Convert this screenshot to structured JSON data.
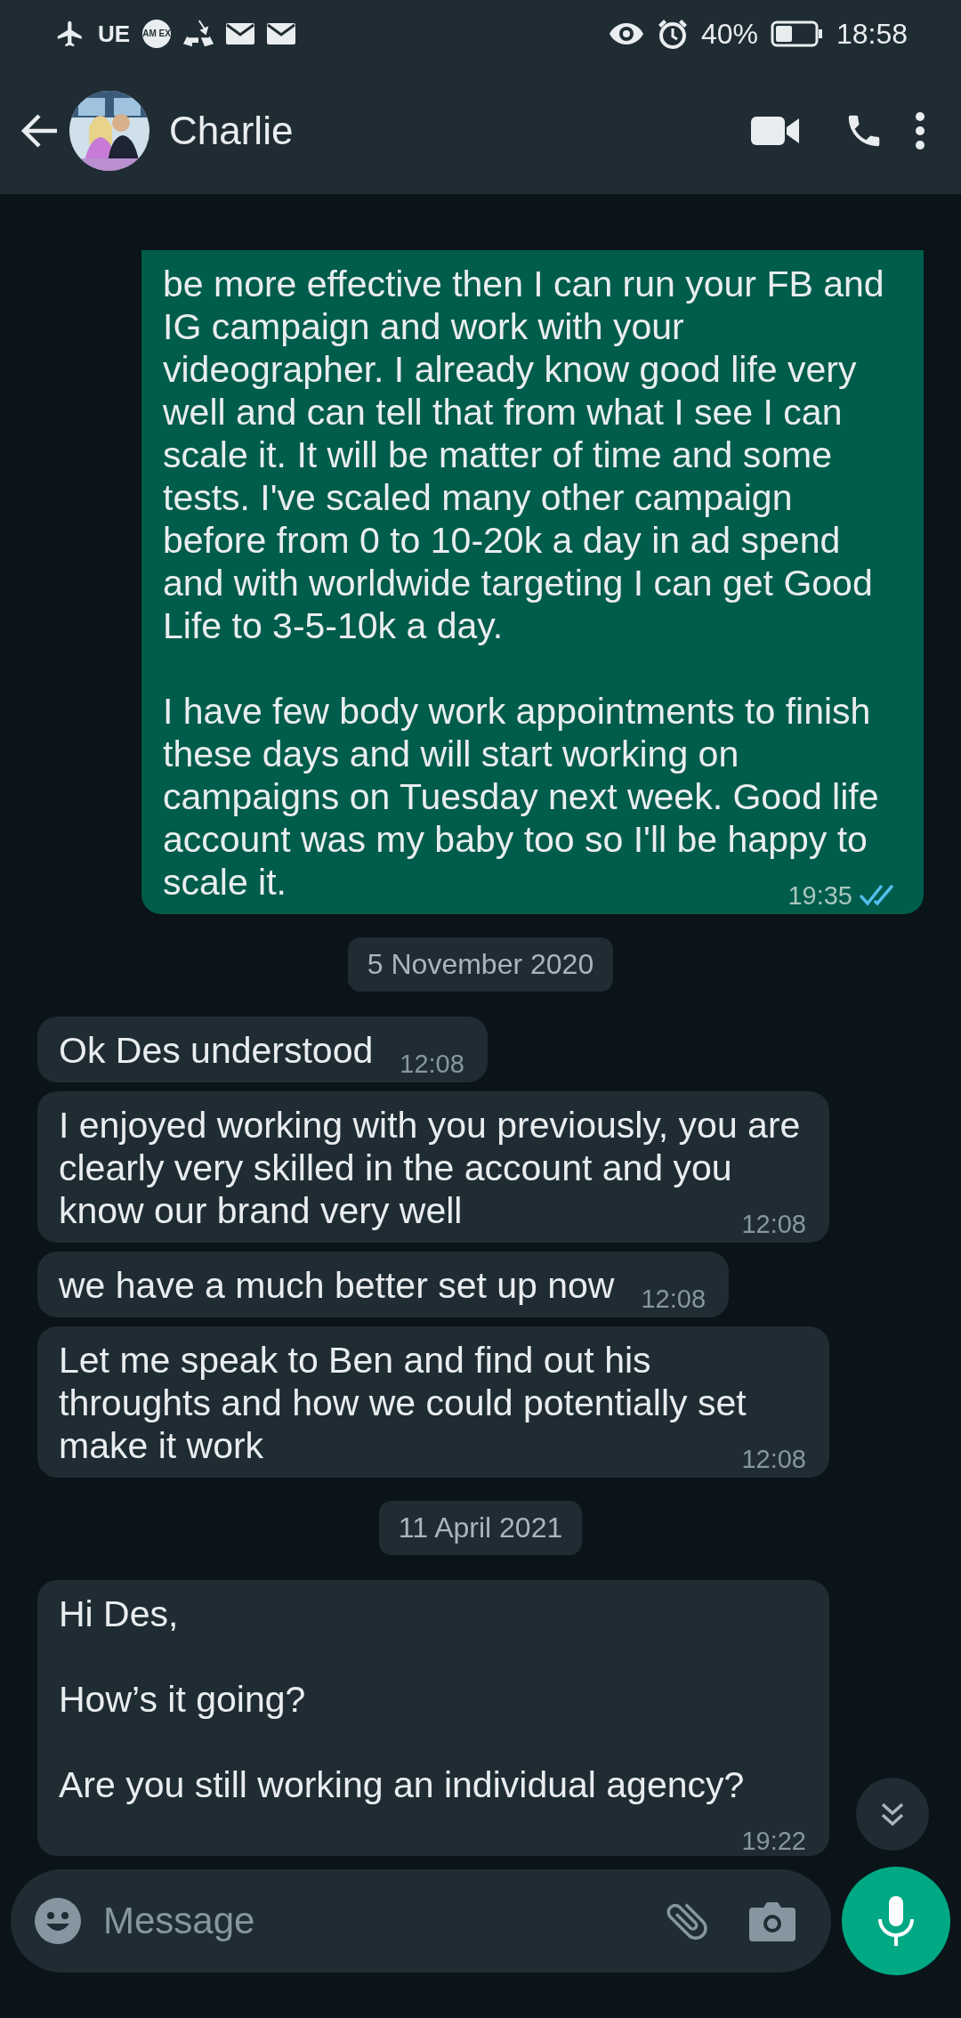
{
  "status_bar": {
    "carrier": "UE",
    "card_badge": "AM EX",
    "battery_percent": "40%",
    "time": "18:58"
  },
  "header": {
    "contact_name": "Charlie"
  },
  "messages": [
    {
      "kind": "sent",
      "text": "be more effective then I can run your FB and IG campaign and work with your videographer. I already know good life very well and can tell that from what I see I can scale it. It will be matter of time and some tests. I've scaled many other campaign before from 0 to 10-20k a day in ad spend and with worldwide targeting I can get Good Life to 3-5-10k a day.\n\nI have few body work appointments to finish these days and will start working on campaigns on Tuesday next week. Good life account was my baby too so I'll be happy to scale it.",
      "time": "19:35",
      "read": true
    },
    {
      "kind": "date",
      "text": "5 November 2020"
    },
    {
      "kind": "received",
      "text": "Ok Des understood",
      "time": "12:08"
    },
    {
      "kind": "received",
      "text": "I enjoyed working with you previously, you are clearly very skilled in the account and you know our brand very well",
      "time": "12:08"
    },
    {
      "kind": "received",
      "text": "we have a much better set up now",
      "time": "12:08"
    },
    {
      "kind": "received",
      "text": "Let me speak to Ben and find out his throughts and how we could potentially set make it work",
      "time": "12:08"
    },
    {
      "kind": "date",
      "text": "11 April 2021"
    },
    {
      "kind": "received",
      "text": "Hi Des,\n\nHow’s it going?\n\nAre you still working an individual agency?",
      "time": "19:22"
    }
  ],
  "composer": {
    "placeholder": "Message"
  }
}
